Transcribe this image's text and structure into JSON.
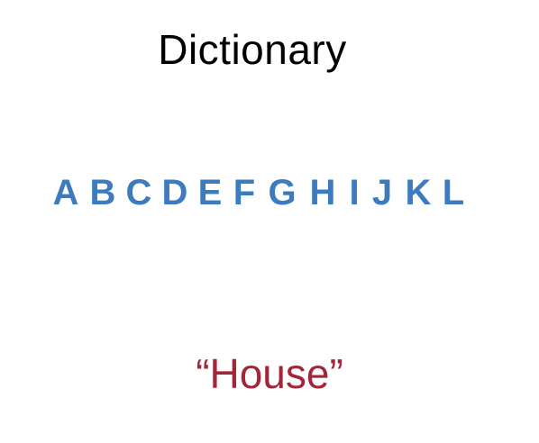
{
  "slide": {
    "title": "Dictionary",
    "letters": [
      "A",
      "B",
      "C",
      "D",
      "E",
      "F",
      "G",
      "H",
      "I",
      "J",
      "K",
      "L"
    ],
    "word": "“House”"
  },
  "colors": {
    "title": "#000000",
    "letters": "#3d7bbf",
    "word": "#a3253a",
    "background": "#ffffff"
  }
}
